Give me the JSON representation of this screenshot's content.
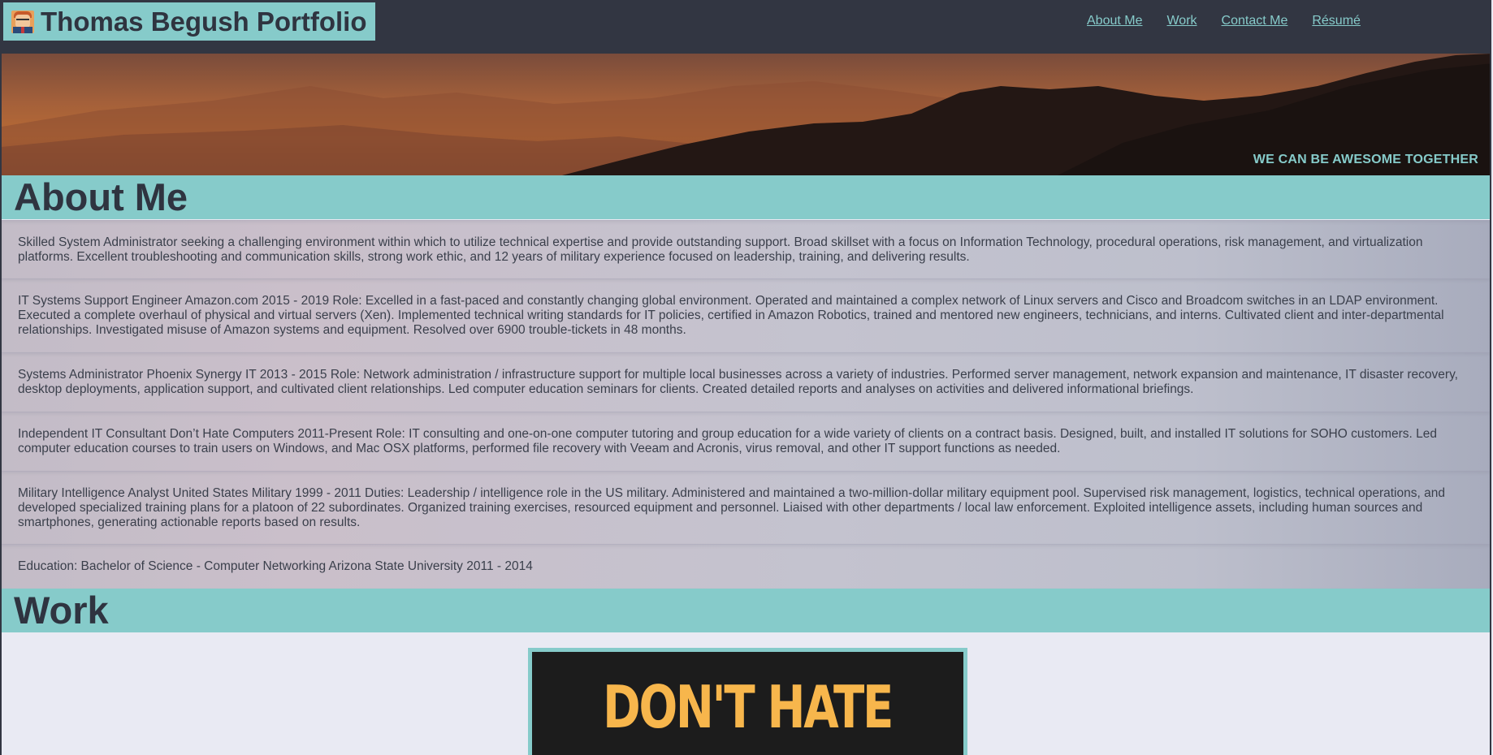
{
  "brand": {
    "title": "Thomas Begush Portfolio",
    "avatar_icon": "avatar-icon"
  },
  "nav": {
    "items": [
      "About Me",
      "Work",
      "Contact Me",
      "Résumé"
    ]
  },
  "hero": {
    "tagline": "WE CAN BE AWESOME TOGETHER"
  },
  "about": {
    "heading": "About Me",
    "entries": [
      "Skilled System Administrator seeking a challenging environment within which to utilize technical expertise and provide outstanding support. Broad skillset with a focus on Information Technology, procedural operations, risk management, and virtualization platforms. Excellent troubleshooting and communication skills, strong work ethic, and 12 years of military experience focused on leadership, training, and delivering results.",
      "IT Systems Support Engineer Amazon.com 2015 - 2019 Role: Excelled in a fast-paced and constantly changing global environment. Operated and maintained a complex network of Linux servers and Cisco and Broadcom switches in an LDAP environment. Executed a complete overhaul of physical and virtual servers (Xen). Implemented technical writing standards for IT policies, certified in Amazon Robotics, trained and mentored new engineers, technicians, and interns. Cultivated client and inter-departmental relationships. Investigated misuse of Amazon systems and equipment. Resolved over 6900 trouble-tickets in 48 months.",
      "Systems Administrator Phoenix Synergy IT 2013 - 2015 Role: Network administration / infrastructure support for multiple local businesses across a variety of industries. Performed server management, network expansion and maintenance, IT disaster recovery, desktop deployments, application support, and cultivated client relationships. Led computer education seminars for clients. Created detailed reports and analyses on activities and delivered informational briefings.",
      "Independent IT Consultant Don’t Hate Computers 2011-Present Role: IT consulting and one-on-one computer tutoring and group education for a wide variety of clients on a contract basis. Designed, built, and installed IT solutions for SOHO customers. Led computer education courses to train users on Windows, and Mac OSX platforms, performed file recovery with Veeam and Acronis, virus removal, and other IT support functions as needed.",
      "Military Intelligence Analyst United States Military 1999 - 2011 Duties: Leadership / intelligence role in the US military. Administered and maintained a two-million-dollar military equipment pool. Supervised risk management, logistics, technical operations, and developed specialized training plans for a platoon of 22 subordinates. Organized training exercises, resourced equipment and personnel. Liaised with other departments / local law enforcement. Exploited intelligence assets, including human sources and smartphones, generating actionable reports based on results.",
      "Education: Bachelor of Science - Computer Networking Arizona State University 2011 - 2014"
    ]
  },
  "work": {
    "heading": "Work",
    "card_text": "DON'T HATE"
  },
  "colors": {
    "accent": "#86cbca",
    "dark": "#323642",
    "card_text": "#f7b64c"
  }
}
